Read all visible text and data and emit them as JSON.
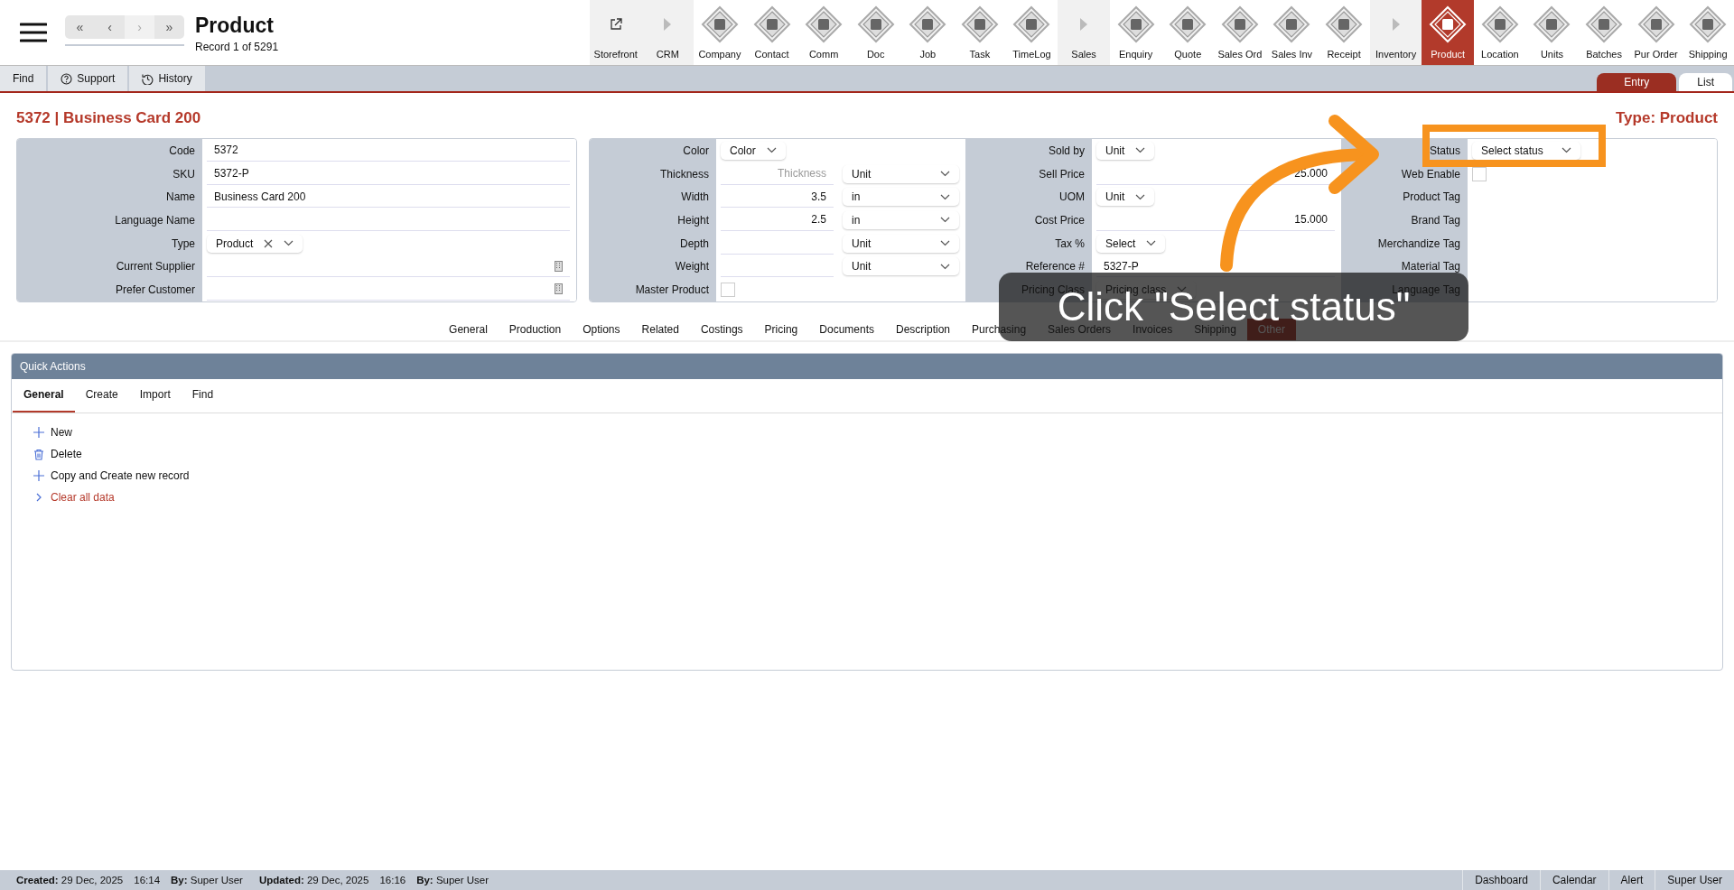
{
  "header": {
    "nav": [
      {
        "glyph": "«",
        "disabled": false
      },
      {
        "glyph": "‹",
        "disabled": false
      },
      {
        "glyph": "›",
        "disabled": true
      },
      {
        "glyph": "»",
        "disabled": false
      }
    ],
    "title": "Product",
    "subtitle": "Record 1 of 5291"
  },
  "modules": [
    {
      "label": "Storefront",
      "kind": "link",
      "selected": false
    },
    {
      "label": "CRM",
      "kind": "group",
      "selected": false
    },
    {
      "label": "Company",
      "kind": "module",
      "selected": false
    },
    {
      "label": "Contact",
      "kind": "module",
      "selected": false
    },
    {
      "label": "Comm",
      "kind": "module",
      "selected": false
    },
    {
      "label": "Doc",
      "kind": "module",
      "selected": false
    },
    {
      "label": "Job",
      "kind": "module",
      "selected": false
    },
    {
      "label": "Task",
      "kind": "module",
      "selected": false
    },
    {
      "label": "TimeLog",
      "kind": "module",
      "selected": false
    },
    {
      "label": "Sales",
      "kind": "group",
      "selected": false
    },
    {
      "label": "Enquiry",
      "kind": "module",
      "selected": false
    },
    {
      "label": "Quote",
      "kind": "module",
      "selected": false
    },
    {
      "label": "Sales Ord",
      "kind": "module",
      "selected": false
    },
    {
      "label": "Sales Inv",
      "kind": "module",
      "selected": false
    },
    {
      "label": "Receipt",
      "kind": "module",
      "selected": false
    },
    {
      "label": "Inventory",
      "kind": "group",
      "selected": false
    },
    {
      "label": "Product",
      "kind": "module",
      "selected": true
    },
    {
      "label": "Location",
      "kind": "module",
      "selected": false
    },
    {
      "label": "Units",
      "kind": "module",
      "selected": false
    },
    {
      "label": "Batches",
      "kind": "module",
      "selected": false
    },
    {
      "label": "Pur Order",
      "kind": "module",
      "selected": false
    },
    {
      "label": "Shipping",
      "kind": "module",
      "selected": false
    }
  ],
  "toolbar": [
    {
      "label": "Find"
    },
    {
      "label": "Support"
    },
    {
      "label": "History"
    }
  ],
  "view_tabs": [
    {
      "label": "Entry",
      "selected": true
    },
    {
      "label": "List",
      "selected": false
    }
  ],
  "record_title": "5372 | Business Card 200",
  "record_type": "Type: Product",
  "form": {
    "panels": [
      {
        "columns": [
          {
            "rows": [
              {
                "label": "Code",
                "kind": "text",
                "value": "5372"
              },
              {
                "label": "SKU",
                "kind": "text",
                "value": "5372-P"
              },
              {
                "label": "Name",
                "kind": "text",
                "value": "Business Card 200"
              },
              {
                "label": "Language Name",
                "kind": "text"
              },
              {
                "label": "Type",
                "kind": "tag-select",
                "value": "Product"
              },
              {
                "label": "Current Supplier",
                "kind": "lookup"
              },
              {
                "label": "Prefer Customer",
                "kind": "lookup"
              }
            ]
          }
        ]
      },
      {
        "columns": [
          {
            "rows": [
              {
                "label": "Color",
                "kind": "select",
                "value": "Color"
              },
              {
                "label": "Thickness",
                "kind": "measure",
                "placeholder": "Thickness",
                "unit": "Unit"
              },
              {
                "label": "Width",
                "kind": "measure",
                "value": "3.5",
                "unit": "in"
              },
              {
                "label": "Height",
                "kind": "measure",
                "value": "2.5",
                "unit": "in"
              },
              {
                "label": "Depth",
                "kind": "measure",
                "unit": "Unit"
              },
              {
                "label": "Weight",
                "kind": "measure",
                "unit": "Unit"
              },
              {
                "label": "Master Product",
                "kind": "checkbox",
                "checked": false
              }
            ]
          },
          {
            "rows": [
              {
                "label": "Sold by",
                "kind": "select",
                "value": "Unit"
              },
              {
                "label": "Sell Price",
                "kind": "number",
                "value": "25.000"
              },
              {
                "label": "UOM",
                "kind": "select",
                "value": "Unit"
              },
              {
                "label": "Cost Price",
                "kind": "number",
                "value": "15.000"
              },
              {
                "label": "Tax %",
                "kind": "select",
                "value": "Select"
              },
              {
                "label": "Reference #",
                "kind": "text",
                "value": "5327-P"
              },
              {
                "label": "Pricing Class",
                "kind": "select",
                "placeholder": "Pricing class"
              }
            ]
          },
          {
            "rows": [
              {
                "label": "Status",
                "kind": "select",
                "placeholder": "Select status"
              },
              {
                "label": "Web Enable",
                "kind": "checkbox",
                "checked": false
              },
              {
                "label": "Product Tag",
                "kind": "tags"
              },
              {
                "label": "Brand Tag",
                "kind": "tags"
              },
              {
                "label": "Merchandize Tag",
                "kind": "tags"
              },
              {
                "label": "Material Tag",
                "kind": "tags"
              },
              {
                "label": "Language Tag",
                "kind": "tags"
              }
            ]
          }
        ]
      }
    ]
  },
  "section_tabs": [
    {
      "label": "General",
      "selected": false
    },
    {
      "label": "Production",
      "selected": false
    },
    {
      "label": "Options",
      "selected": false
    },
    {
      "label": "Related",
      "selected": false
    },
    {
      "label": "Costings",
      "selected": false
    },
    {
      "label": "Pricing",
      "selected": false
    },
    {
      "label": "Documents",
      "selected": false
    },
    {
      "label": "Description",
      "selected": false
    },
    {
      "label": "Purchasing",
      "selected": false
    },
    {
      "label": "Sales Orders",
      "selected": false
    },
    {
      "label": "Invoices",
      "selected": false
    },
    {
      "label": "Shipping",
      "selected": false
    },
    {
      "label": "Other",
      "selected": true
    }
  ],
  "quick_actions": {
    "title": "Quick Actions",
    "tabs": [
      {
        "label": "General",
        "selected": true
      },
      {
        "label": "Create",
        "selected": false
      },
      {
        "label": "Import",
        "selected": false
      },
      {
        "label": "Find",
        "selected": false
      }
    ],
    "items": [
      {
        "label": "New",
        "kind": "add"
      },
      {
        "label": "Delete",
        "kind": "delete"
      },
      {
        "label": "Copy and Create new record",
        "kind": "add"
      },
      {
        "label": "Clear all data",
        "kind": "danger"
      }
    ]
  },
  "tooltip": {
    "text": "Click \"Select status\""
  },
  "status_bar": {
    "left": [
      "**Created:** 29 Dec, 2025",
      "16:14",
      "**By:** Super User",
      "**Updated:** 29 Dec, 2025",
      "16:16",
      "**By:** Super User"
    ],
    "right": [
      "Dashboard",
      "Calendar",
      "Alert",
      "Super User"
    ]
  }
}
